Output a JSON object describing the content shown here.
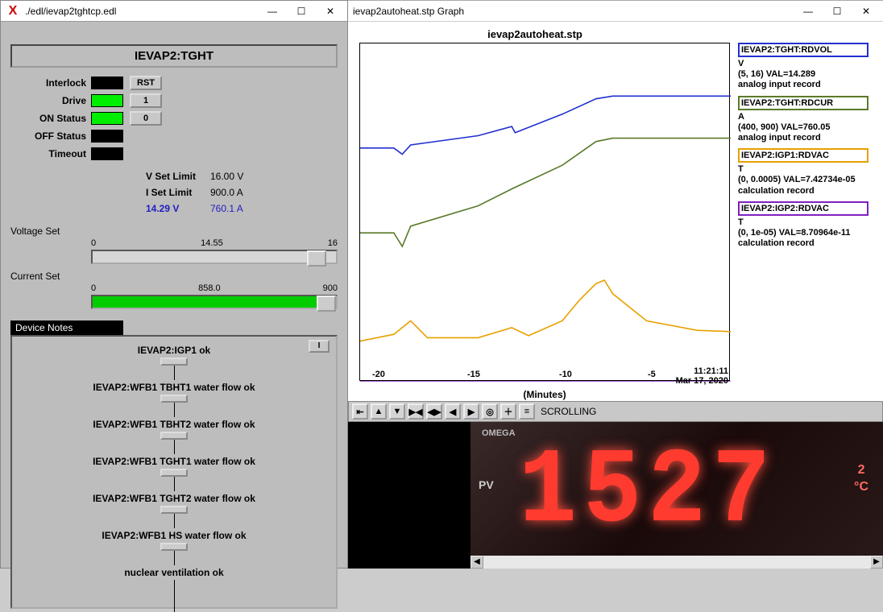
{
  "left_window": {
    "title": "./edl/ievap2tghtcp.edl",
    "heading": "IEVAP2:TGHT",
    "status": {
      "interlock": {
        "label": "Interlock",
        "on": false
      },
      "drive": {
        "label": "Drive",
        "on": true
      },
      "on_status": {
        "label": "ON Status",
        "on": true
      },
      "off_status": {
        "label": "OFF Status",
        "on": false
      },
      "timeout": {
        "label": "Timeout",
        "on": false
      }
    },
    "buttons": {
      "rst": "RST",
      "one": "1",
      "zero": "0"
    },
    "set_limits": {
      "v_label": "V Set Limit",
      "v_value": "16.00 V",
      "i_label": "I Set Limit",
      "i_value": "900.0 A",
      "live_v": "14.29 V",
      "live_i": "760.1 A"
    },
    "sliders": {
      "voltage": {
        "label": "Voltage Set",
        "min": "0",
        "mid": "14.55",
        "max": "16",
        "frac": 0.91
      },
      "current": {
        "label": "Current Set",
        "min": "0",
        "mid": "858.0",
        "max": "900",
        "frac": 0.95
      }
    },
    "device_notes_label": "Device Notes",
    "notes_i_btn": "I",
    "tree_nodes": [
      "IEVAP2:IGP1 ok",
      "IEVAP2:WFB1 TBHT1 water flow ok",
      "IEVAP2:WFB1 TBHT2 water flow ok",
      "IEVAP2:WFB1 TGHT1 water flow ok",
      "IEVAP2:WFB1 TGHT2 water flow ok",
      "IEVAP2:WFB1 HS water flow ok",
      "nuclear ventilation ok"
    ]
  },
  "right_window": {
    "title": "ievap2autoheat.stp Graph",
    "graph_title": "ievap2autoheat.stp",
    "xaxis_label": "(Minutes)",
    "xaxis_time": "11:21:11",
    "xaxis_date": "Mar 17, 2020",
    "xticks": [
      "-20",
      "-15",
      "-10",
      "-5"
    ],
    "toolbar_label": "SCROLLING",
    "legend": [
      {
        "tag": "IEVAP2:TGHT:RDVOL",
        "unit": "V",
        "range": "(5, 16) VAL=14.289",
        "rec": "analog input record",
        "color": "#2030d0"
      },
      {
        "tag": "IEVAP2:TGHT:RDCUR",
        "unit": "A",
        "range": "(400, 900) VAL=760.05",
        "rec": "analog input record",
        "color": "#5a7a2a"
      },
      {
        "tag": "IEVAP2:IGP1:RDVAC",
        "unit": "T",
        "range": "(0, 0.0005) VAL=7.42734e-05",
        "rec": "calculation record",
        "color": "#e8a000"
      },
      {
        "tag": "IEVAP2:IGP2:RDVAC",
        "unit": "T",
        "range": "(0, 1e-05) VAL=8.70964e-11",
        "rec": "calculation record",
        "color": "#8020c0"
      }
    ]
  },
  "camera": {
    "brand": "OMEGA",
    "pv_label": "PV",
    "temp_value": "1527",
    "temp_unit_top": "2",
    "temp_unit": "°C"
  },
  "chart_data": {
    "type": "line",
    "xlabel": "Minutes",
    "x_range": [
      -22,
      0
    ],
    "time": "11:21:11 Mar 17, 2020",
    "series": [
      {
        "name": "IEVAP2:TGHT:RDVOL",
        "unit": "V",
        "ylim": [
          5,
          16
        ],
        "color": "#2030d0",
        "x": [
          -22,
          -20,
          -19.5,
          -19,
          -15,
          -13,
          -12.8,
          -10,
          -8,
          -7,
          0
        ],
        "y": [
          12.6,
          12.6,
          12.4,
          12.7,
          13.0,
          13.3,
          13.1,
          13.7,
          14.2,
          14.29,
          14.29
        ]
      },
      {
        "name": "IEVAP2:TGHT:RDCUR",
        "unit": "A",
        "ylim": [
          400,
          900
        ],
        "color": "#5a7a2a",
        "x": [
          -22,
          -20,
          -19.5,
          -19,
          -15,
          -13,
          -10,
          -8,
          -7,
          0
        ],
        "y": [
          620,
          620,
          600,
          630,
          660,
          685,
          720,
          755,
          760,
          760
        ]
      },
      {
        "name": "IEVAP2:IGP1:RDVAC",
        "unit": "Torr",
        "ylim": [
          0,
          0.0005
        ],
        "color": "#e8a000",
        "x": [
          -22,
          -20,
          -19,
          -18,
          -15,
          -13,
          -12,
          -10,
          -9,
          -8,
          -7.5,
          -7,
          -5,
          -2,
          0
        ],
        "y": [
          6e-05,
          7e-05,
          9e-05,
          6.5e-05,
          6.5e-05,
          8e-05,
          6.8e-05,
          9e-05,
          0.00012,
          0.000145,
          0.00015,
          0.00013,
          9e-05,
          7.6e-05,
          7.4e-05
        ]
      },
      {
        "name": "IEVAP2:IGP2:RDVAC",
        "unit": "Torr",
        "ylim": [
          0,
          1e-05
        ],
        "color": "#8020c0",
        "x": [
          -22,
          0
        ],
        "y": [
          8.7e-11,
          8.7e-11
        ]
      }
    ]
  }
}
